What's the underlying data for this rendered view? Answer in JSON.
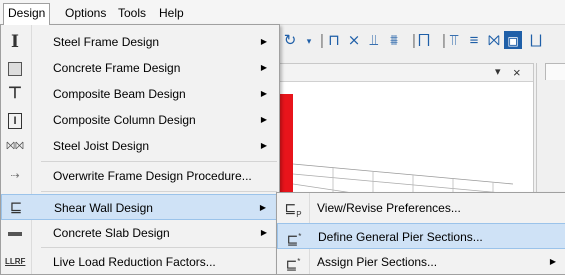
{
  "menubar": {
    "items": [
      {
        "label": "Design"
      },
      {
        "label": "Options"
      },
      {
        "label": "Tools"
      },
      {
        "label": "Help"
      }
    ]
  },
  "design_menu": {
    "items": [
      {
        "label": "Steel Frame Design",
        "icon": "i-beam-icon",
        "submenu": true
      },
      {
        "label": "Concrete Frame Design",
        "icon": "concrete-frame-icon",
        "submenu": true
      },
      {
        "label": "Composite Beam Design",
        "icon": "composite-beam-icon",
        "submenu": true
      },
      {
        "label": "Composite Column Design",
        "icon": "composite-column-icon",
        "submenu": true
      },
      {
        "label": "Steel Joist Design",
        "icon": "steel-joist-icon",
        "submenu": true
      },
      {
        "label": "Overwrite Frame Design Procedure...",
        "icon": "overwrite-procedure-icon",
        "submenu": false
      },
      {
        "label": "Shear Wall Design",
        "icon": "shear-wall-icon",
        "submenu": true
      },
      {
        "label": "Concrete Slab Design",
        "icon": "concrete-slab-icon",
        "submenu": true
      },
      {
        "label": "Live Load Reduction Factors...",
        "icon": "llrf-icon",
        "icon_text": "LLRF",
        "submenu": false
      }
    ]
  },
  "shear_wall_submenu": {
    "items": [
      {
        "label": "View/Revise Preferences...",
        "icon": "preferences-icon",
        "submenu": false
      },
      {
        "label": "Define General Pier Sections...",
        "icon": "define-pier-icon",
        "submenu": false
      },
      {
        "label": "Assign Pier Sections...",
        "icon": "assign-pier-icon",
        "submenu": true
      }
    ]
  },
  "window": {
    "close_glyph": "×",
    "dropdown_glyph": "▾"
  },
  "colors": {
    "highlight": "#cfe2f6",
    "highlight_border": "#9bc3ea",
    "model_red": "#e8141b"
  }
}
